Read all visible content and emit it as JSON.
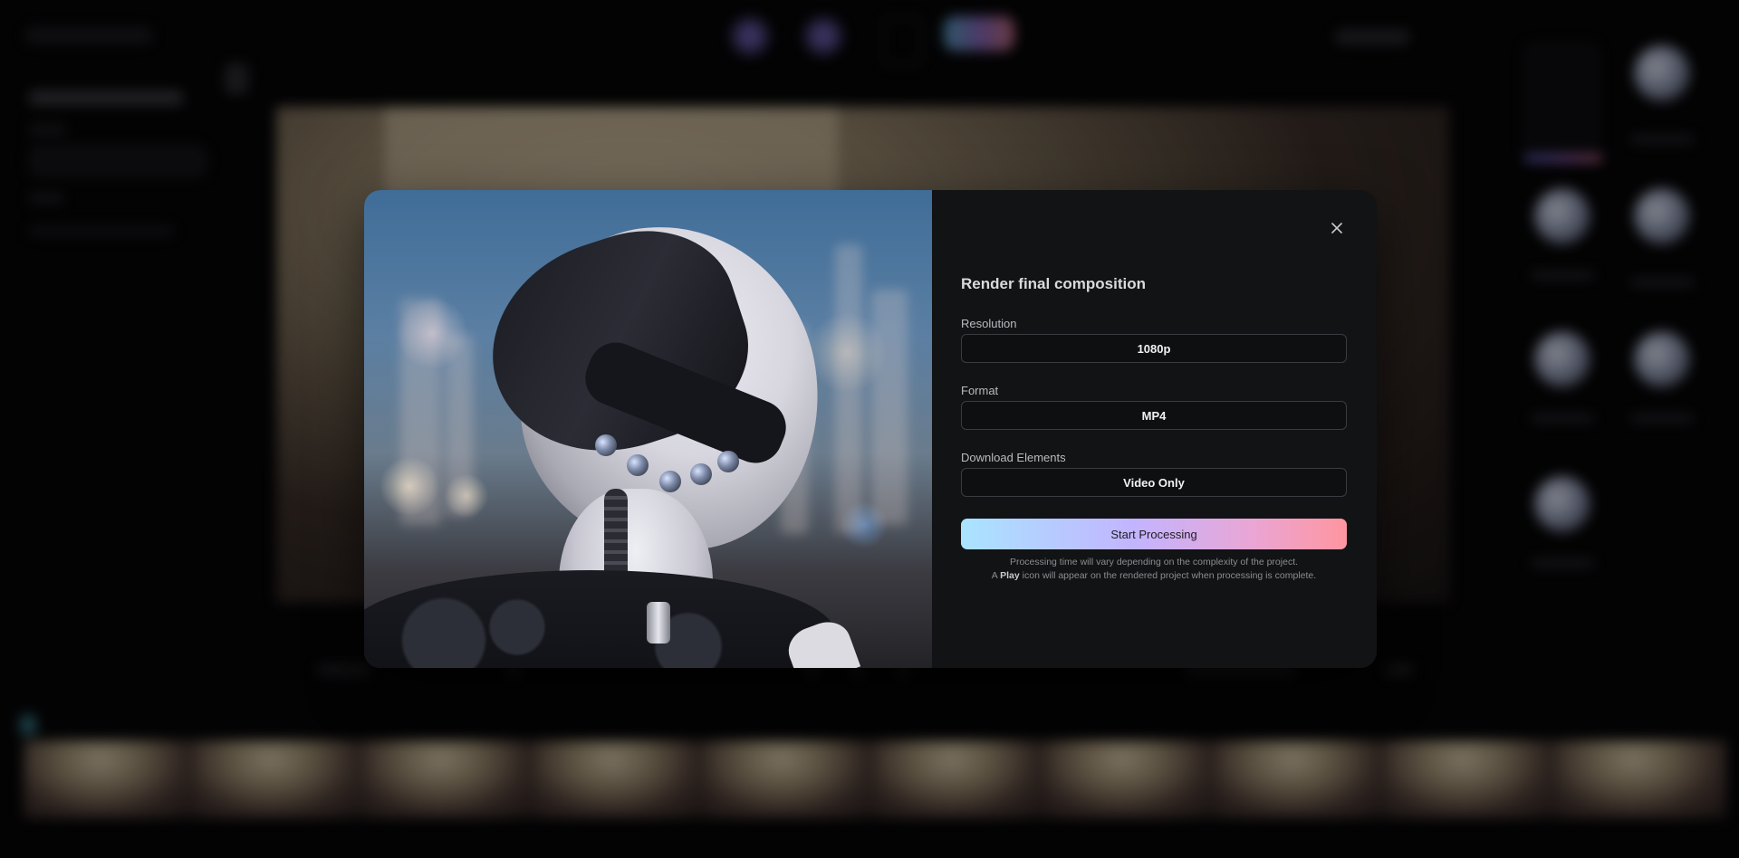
{
  "modal": {
    "title": "Render final composition",
    "close_icon": "close-icon",
    "image_alt": "cyborg-helmet-portrait",
    "fields": [
      {
        "label": "Resolution",
        "value": "1080p"
      },
      {
        "label": "Format",
        "value": "MP4"
      },
      {
        "label": "Download Elements",
        "value": "Video Only"
      }
    ],
    "primary_button": "Start Processing",
    "note_line1": "Processing time will vary depending on the complexity of the project.",
    "note_line2_prefix": "A ",
    "note_line2_bold": "Play",
    "note_line2_suffix": " icon will appear on the rendered project when processing is complete."
  },
  "colors": {
    "modal_bg": "#121315",
    "overlay_bg": "#050506",
    "button_gradient": [
      "#a9e4ff",
      "#c3b4ff",
      "#e9a6d5",
      "#ff95a0"
    ]
  }
}
